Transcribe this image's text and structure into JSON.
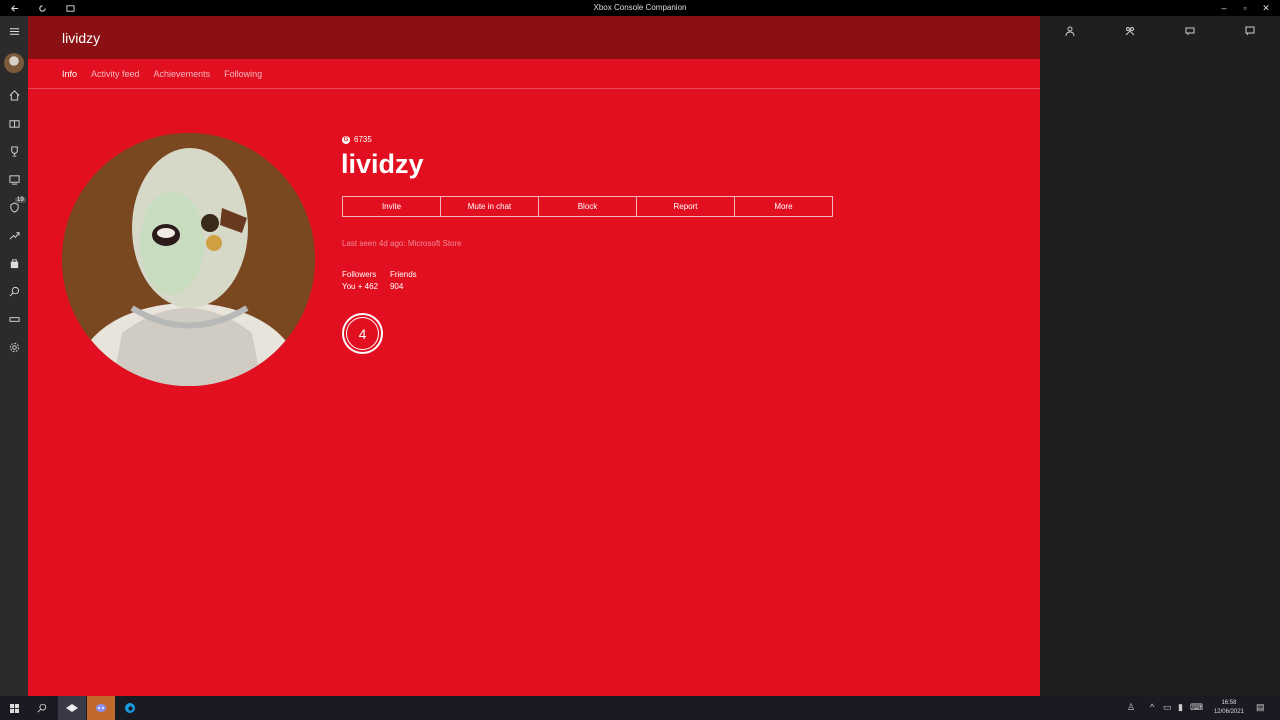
{
  "window": {
    "title": "Xbox Console Companion"
  },
  "sidebar": {
    "badge": "19"
  },
  "header": {
    "title": "lividzy"
  },
  "tabs": [
    {
      "label": "Info",
      "active": true
    },
    {
      "label": "Activity feed",
      "active": false
    },
    {
      "label": "Achievements",
      "active": false
    },
    {
      "label": "Following",
      "active": false
    }
  ],
  "profile": {
    "gamerscore_icon": "G",
    "gamerscore": "6735",
    "gamertag": "lividzy",
    "last_seen": "Last seen 4d ago: Microsoft Store",
    "followers_label": "Followers",
    "followers_value": "You + 462",
    "friends_label": "Friends",
    "friends_value": "904",
    "reputation_level": "4"
  },
  "actions": [
    "Invite",
    "Mute in chat",
    "Block",
    "Report",
    "More"
  ],
  "taskbar": {
    "time": "16:58",
    "date": "12/06/2021"
  },
  "colors": {
    "accent": "#e20f21",
    "header": "#8a1014",
    "sidebar": "#2b2b2b",
    "rightpanel": "#1f1f1f"
  }
}
